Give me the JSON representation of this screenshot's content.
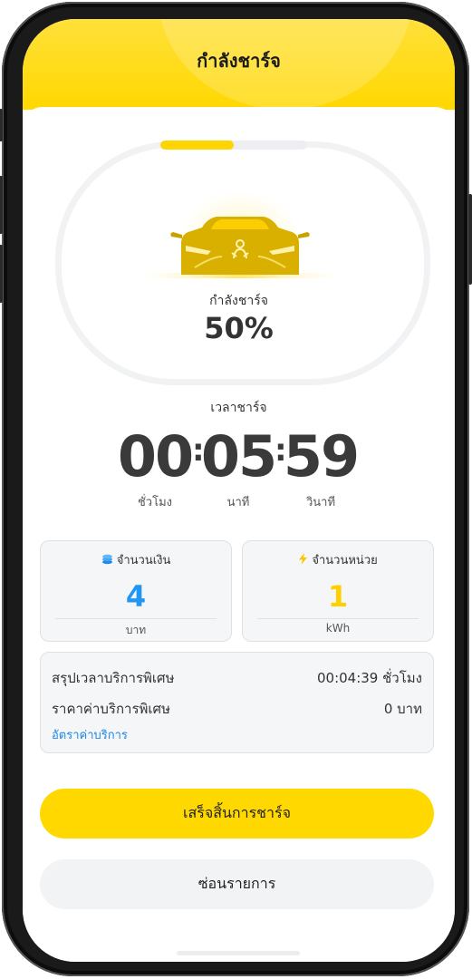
{
  "header": {
    "title": "กำลังชาร์จ"
  },
  "charging": {
    "progress_fraction": 0.5,
    "status_label": "กำลังชาร์จ",
    "percent": "50%",
    "car_icon": "car-charging-icon"
  },
  "timer": {
    "label": "เวลาชาร์จ",
    "hours": "00",
    "minutes": "05",
    "seconds": "59",
    "separator": ":",
    "hours_unit": "ชั่วโมง",
    "minutes_unit": "นาที",
    "seconds_unit": "วินาที"
  },
  "cards": {
    "amount": {
      "icon": "coins-icon",
      "title": "จำนวนเงิน",
      "value": "4",
      "unit": "บาท",
      "color": "#2196f3"
    },
    "energy": {
      "icon": "lightning-icon",
      "title": "จำนวนหน่วย",
      "value": "1",
      "unit": "kWh",
      "color": "#ffd000"
    }
  },
  "summary": {
    "special_time_label": "สรุปเวลาบริการพิเศษ",
    "special_time_value": "00:04:39 ชั่วโมง",
    "special_price_label": "ราคาค่าบริการพิเศษ",
    "special_price_value": "0 บาท",
    "rate_link": "อัตราค่าบริการ"
  },
  "buttons": {
    "finish": "เสร็จสิ้นการชาร์จ",
    "hide": "ซ่อนรายการ"
  },
  "colors": {
    "accent": "#ffd800",
    "link": "#1e88e5",
    "text": "#333333"
  }
}
